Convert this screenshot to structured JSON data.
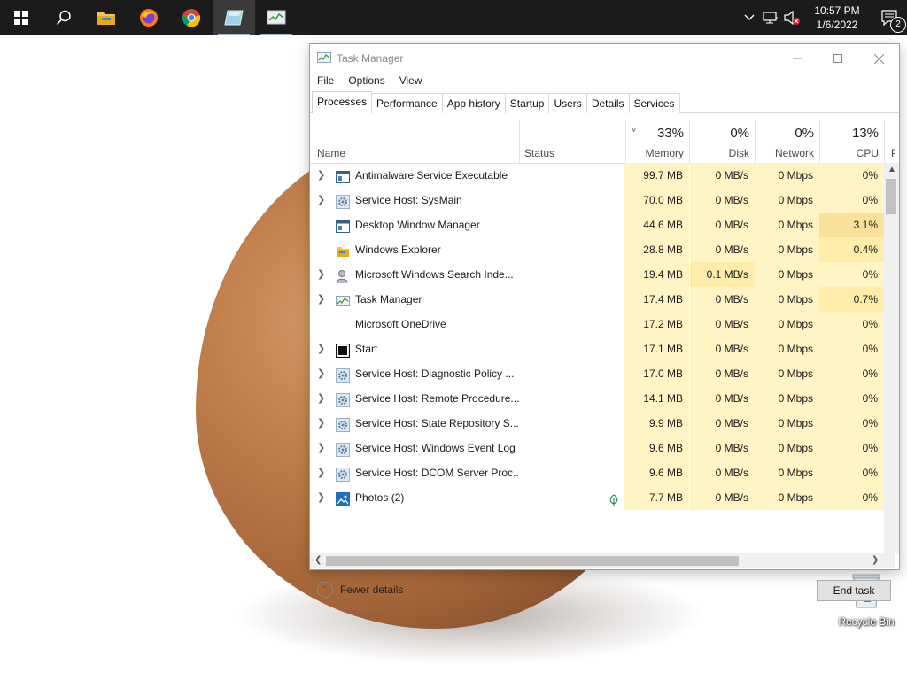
{
  "taskbar": {
    "apps": [
      {
        "name": "start-button",
        "icon": "windows-logo-icon"
      },
      {
        "name": "search-button",
        "icon": "search-icon"
      },
      {
        "name": "file-explorer-button",
        "icon": "folder-icon"
      },
      {
        "name": "firefox-button",
        "icon": "firefox-icon"
      },
      {
        "name": "chrome-button",
        "icon": "chrome-icon"
      },
      {
        "name": "app-button-1",
        "icon": "app-window-icon"
      },
      {
        "name": "task-manager-taskbar-button",
        "icon": "task-manager-icon"
      }
    ],
    "clock": {
      "time": "10:57 PM",
      "date": "1/6/2022"
    },
    "notifications": {
      "count": "2"
    }
  },
  "desktop": {
    "recycle_bin_label": "Recycle Bin"
  },
  "window": {
    "title": "Task Manager",
    "menu": [
      "File",
      "Options",
      "View"
    ],
    "tabs": [
      "Processes",
      "Performance",
      "App history",
      "Startup",
      "Users",
      "Details",
      "Services"
    ],
    "active_tab": "Processes",
    "columns": {
      "name": "Name",
      "status": "Status",
      "memory": {
        "label": "Memory",
        "pct": "33%"
      },
      "disk": {
        "label": "Disk",
        "pct": "0%"
      },
      "network": {
        "label": "Network",
        "pct": "0%"
      },
      "cpu": {
        "label": "CPU",
        "pct": "13%"
      },
      "extra": "P"
    },
    "processes": [
      {
        "name": "Antimalware Service Executable",
        "expandable": true,
        "icon": "app-window-icon",
        "memory": "99.7 MB",
        "disk": "0 MB/s",
        "network": "0 Mbps",
        "cpu": "0%"
      },
      {
        "name": "Service Host: SysMain",
        "expandable": true,
        "icon": "gear-icon",
        "memory": "70.0 MB",
        "disk": "0 MB/s",
        "network": "0 Mbps",
        "cpu": "0%"
      },
      {
        "name": "Desktop Window Manager",
        "expandable": false,
        "icon": "app-window-icon",
        "memory": "44.6 MB",
        "disk": "0 MB/s",
        "network": "0 Mbps",
        "cpu": "3.1%"
      },
      {
        "name": "Windows Explorer",
        "expandable": false,
        "icon": "folder-icon",
        "memory": "28.8 MB",
        "disk": "0 MB/s",
        "network": "0 Mbps",
        "cpu": "0.4%"
      },
      {
        "name": "Microsoft Windows Search Inde...",
        "expandable": true,
        "icon": "user-search-icon",
        "memory": "19.4 MB",
        "disk": "0.1 MB/s",
        "network": "0 Mbps",
        "cpu": "0%"
      },
      {
        "name": "Task Manager",
        "expandable": true,
        "icon": "task-manager-icon",
        "memory": "17.4 MB",
        "disk": "0 MB/s",
        "network": "0 Mbps",
        "cpu": "0.7%"
      },
      {
        "name": "Microsoft OneDrive",
        "expandable": false,
        "icon": "",
        "memory": "17.2 MB",
        "disk": "0 MB/s",
        "network": "0 Mbps",
        "cpu": "0%"
      },
      {
        "name": "Start",
        "expandable": true,
        "icon": "start-icon",
        "memory": "17.1 MB",
        "disk": "0 MB/s",
        "network": "0 Mbps",
        "cpu": "0%"
      },
      {
        "name": "Service Host: Diagnostic Policy ...",
        "expandable": true,
        "icon": "gear-icon",
        "memory": "17.0 MB",
        "disk": "0 MB/s",
        "network": "0 Mbps",
        "cpu": "0%"
      },
      {
        "name": "Service Host: Remote Procedure...",
        "expandable": true,
        "icon": "gear-icon",
        "memory": "14.1 MB",
        "disk": "0 MB/s",
        "network": "0 Mbps",
        "cpu": "0%"
      },
      {
        "name": "Service Host: State Repository S...",
        "expandable": true,
        "icon": "gear-icon",
        "memory": "9.9 MB",
        "disk": "0 MB/s",
        "network": "0 Mbps",
        "cpu": "0%"
      },
      {
        "name": "Service Host: Windows Event Log",
        "expandable": true,
        "icon": "gear-icon",
        "memory": "9.6 MB",
        "disk": "0 MB/s",
        "network": "0 Mbps",
        "cpu": "0%"
      },
      {
        "name": "Service Host: DCOM Server Proc...",
        "expandable": true,
        "icon": "gear-icon",
        "memory": "9.6 MB",
        "disk": "0 MB/s",
        "network": "0 Mbps",
        "cpu": "0%"
      },
      {
        "name": "Photos (2)",
        "expandable": true,
        "icon": "photos-icon",
        "status_icon": "leaf-icon",
        "memory": "7.7 MB",
        "disk": "0 MB/s",
        "network": "0 Mbps",
        "cpu": "0%"
      }
    ],
    "fewer_details": "Fewer details",
    "end_task": "End task"
  },
  "colors": {
    "taskbar": "#1b1b1b",
    "heat_light": "#fff4c4",
    "heat_medium": "#ffecab",
    "heat_strong": "#f9e199",
    "accent": "#0078d7"
  }
}
